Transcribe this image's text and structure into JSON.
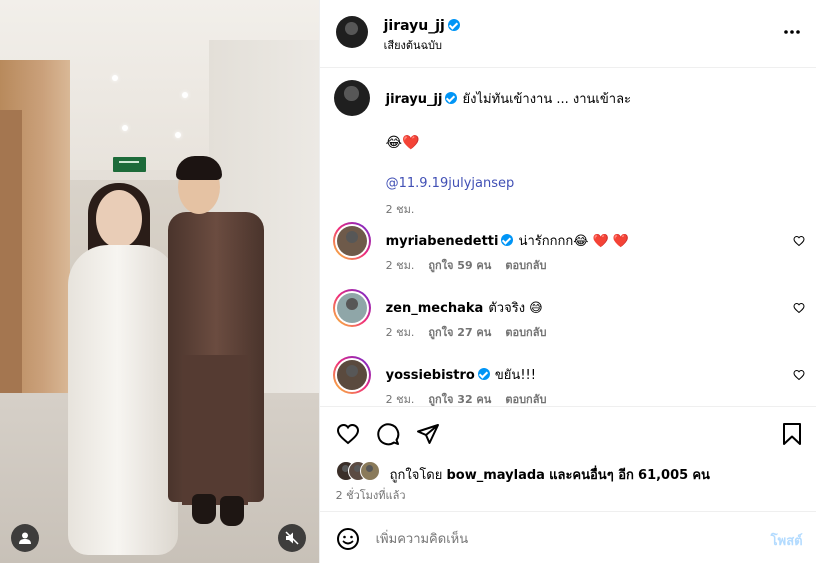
{
  "post": {
    "author": "jirayu_jj",
    "audio": "เสียงต้นฉบับ",
    "caption": "ยังไม่ทันเข้างาน ... งานเข้าละ",
    "caption_emoji": "😂❤️",
    "mention": "@11.9.19julyjansep",
    "caption_time": "2 ชม."
  },
  "comments": [
    {
      "user": "myriabenedetti",
      "verified": true,
      "text": "น่ารักกกก😂 ❤️ ❤️",
      "time": "2 ชม.",
      "likes": "ถูกใจ 59 คน",
      "reply": "ตอบกลับ"
    },
    {
      "user": "zen_mechaka",
      "verified": false,
      "text": "ตัวจริง 😅",
      "time": "2 ชม.",
      "likes": "ถูกใจ 27 คน",
      "reply": "ตอบกลับ"
    },
    {
      "user": "yossiebistro",
      "verified": true,
      "text": "ขยัน!!!",
      "time": "2 ชม.",
      "likes": "ถูกใจ 32 คน",
      "reply": "ตอบกลับ"
    }
  ],
  "likes": {
    "prefix": "ถูกใจโดย",
    "user": "bow_maylada",
    "middle": "และคนอื่นๆ อีก",
    "count": "61,005",
    "suffix": "คน"
  },
  "posted": "2 ชั่วโมงที่แล้ว",
  "composer": {
    "placeholder": "เพิ่มความคิดเห็น",
    "post_label": "โพสต์"
  },
  "colors": {
    "link": "#00376b",
    "mention": "#4150b5",
    "verified": "#0095f6",
    "post_button_disabled": "#b3dbff"
  },
  "icons": [
    "more-icon",
    "heart-icon",
    "comment-icon",
    "share-icon",
    "bookmark-icon",
    "emoji-icon",
    "user-tag-icon",
    "mute-icon"
  ]
}
